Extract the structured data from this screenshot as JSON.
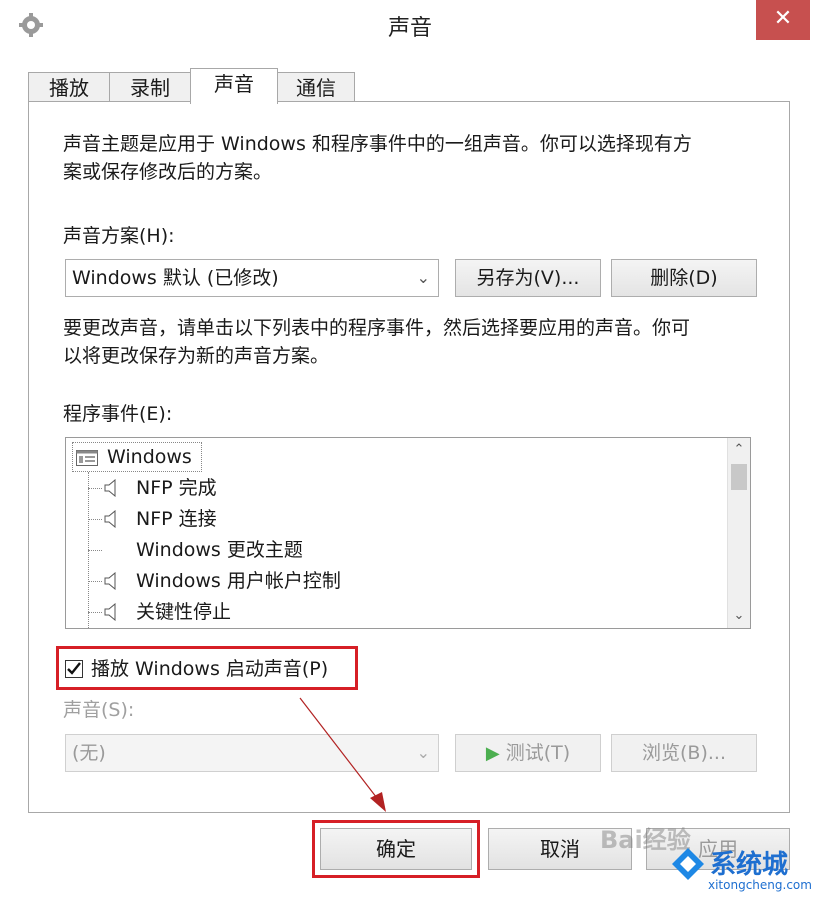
{
  "window": {
    "title": "声音",
    "close_glyph": "✕",
    "close_color": "#c7504f"
  },
  "tabs": [
    {
      "label": "播放",
      "active": false
    },
    {
      "label": "录制",
      "active": false
    },
    {
      "label": "声音",
      "active": true
    },
    {
      "label": "通信",
      "active": false
    }
  ],
  "sounds_tab": {
    "description": [
      "声音主题是应用于 Windows 和程序事件中的一组声音。你可以选择现有方",
      "案或保存修改后的方案。"
    ],
    "scheme_label": "声音方案(H):",
    "scheme_value": "Windows 默认 (已修改)",
    "save_as_button": "另存为(V)...",
    "delete_button": "删除(D)",
    "instructions": [
      "要更改声音，请单击以下列表中的程序事件，然后选择要应用的声音。你可",
      "以将更改保存为新的声音方案。"
    ],
    "events_label": "程序事件(E):",
    "events": [
      {
        "label": "Windows",
        "level": 0,
        "icon": "app-group-icon"
      },
      {
        "label": "NFP 完成",
        "level": 1,
        "icon": "speaker-icon"
      },
      {
        "label": "NFP 连接",
        "level": 1,
        "icon": "speaker-icon"
      },
      {
        "label": "Windows 更改主题",
        "level": 1,
        "icon": ""
      },
      {
        "label": "Windows 用户帐户控制",
        "level": 1,
        "icon": "speaker-icon"
      },
      {
        "label": "关键性停止",
        "level": 1,
        "icon": "speaker-icon"
      }
    ],
    "startup_checkbox_label": "播放 Windows 启动声音(P)",
    "startup_checked": true,
    "sound_label": "声音(S):",
    "sound_value": "(无)",
    "test_button": "测试(T)",
    "browse_button": "浏览(B)..."
  },
  "footer": {
    "ok_button": "确定",
    "cancel_button": "取消",
    "apply_button": "应用"
  },
  "highlight_color": "#d61f26",
  "watermark": {
    "baidu_text": "Bai经验",
    "site_name": "系统城",
    "site_url": "xitongcheng.com"
  }
}
